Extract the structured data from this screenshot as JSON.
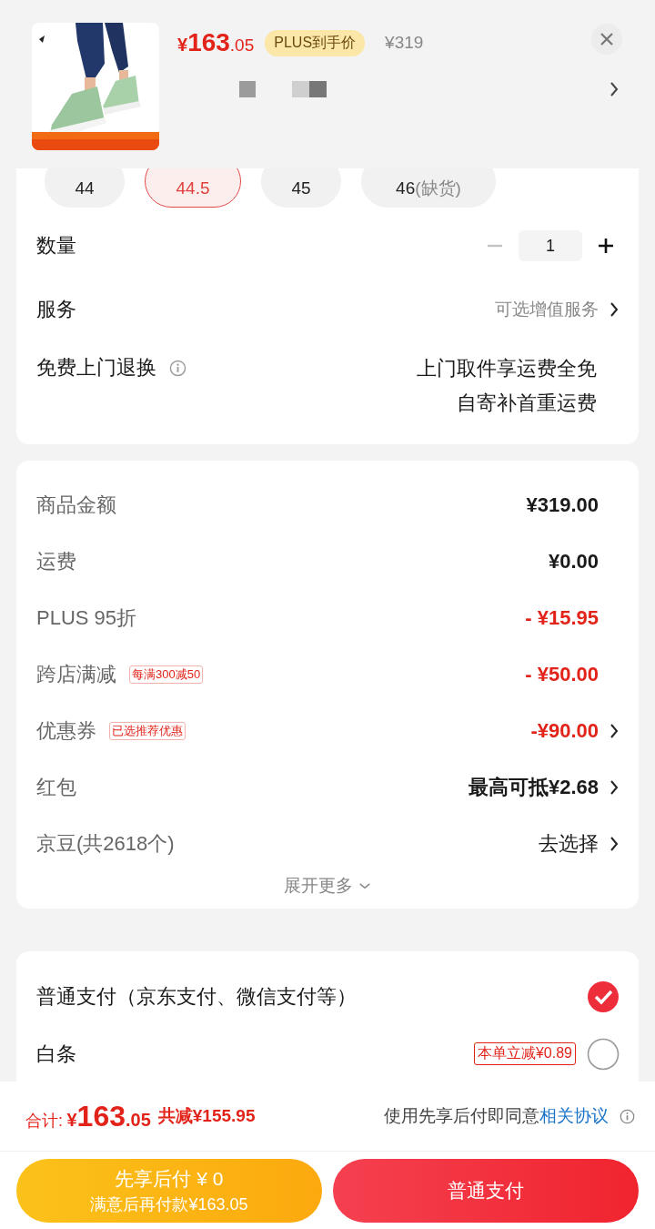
{
  "product": {
    "price_symbol": "¥",
    "price_int": "163",
    "price_dec": ".05",
    "badge": "PLUS到手价",
    "original_price": "¥319"
  },
  "sizes": [
    {
      "label": "44",
      "selected": false
    },
    {
      "label": "44.5",
      "selected": true
    },
    {
      "label": "45",
      "selected": false
    },
    {
      "label": "46",
      "note": "(缺货)",
      "selected": false
    }
  ],
  "quantity": {
    "label": "数量",
    "value": "1",
    "decrease_disabled": true
  },
  "service": {
    "label": "服务",
    "value": "可选增值服务"
  },
  "returns": {
    "label": "免费上门退换",
    "lines": [
      "上门取件享运费全免",
      "自寄补首重运费"
    ]
  },
  "summary": [
    {
      "label": "商品金额",
      "value": "¥319.00",
      "kind": "bold",
      "arrow": false
    },
    {
      "label": "运费",
      "value": "¥0.00",
      "kind": "bold",
      "arrow": false
    },
    {
      "label": "PLUS 95折",
      "value": "- ¥15.95",
      "kind": "discount",
      "arrow": false
    },
    {
      "label": "跨店满减",
      "tag": "每满300减50",
      "value": "- ¥50.00",
      "kind": "discount",
      "arrow": false
    },
    {
      "label": "优惠券",
      "tag": "已选推荐优惠",
      "value": "-¥90.00",
      "kind": "discount",
      "arrow": true
    },
    {
      "label": "红包",
      "value": "最高可抵¥2.68",
      "kind": "bold",
      "arrow": true
    },
    {
      "label": "京豆(共2618个)",
      "value": "去选择",
      "kind": "plain",
      "arrow": true
    }
  ],
  "expand": "展开更多",
  "payments": [
    {
      "label": "普通支付（京东支付、微信支付等）",
      "selected": true
    },
    {
      "label": "白条",
      "tag": "本单立减¥0.89",
      "selected": false
    }
  ],
  "footer": {
    "total_label": "合计:",
    "total_symbol": "¥",
    "total_int": "163",
    "total_dec": ".05",
    "saving": "共减¥155.95",
    "agreement_text": "使用先享后付即同意",
    "agreement_link": "相关协议"
  },
  "buttons": [
    {
      "kind": "later",
      "title": "先享后付 ¥ 0",
      "subtitle": "满意后再付款¥163.05"
    },
    {
      "kind": "pay",
      "title": "普通支付"
    }
  ]
}
